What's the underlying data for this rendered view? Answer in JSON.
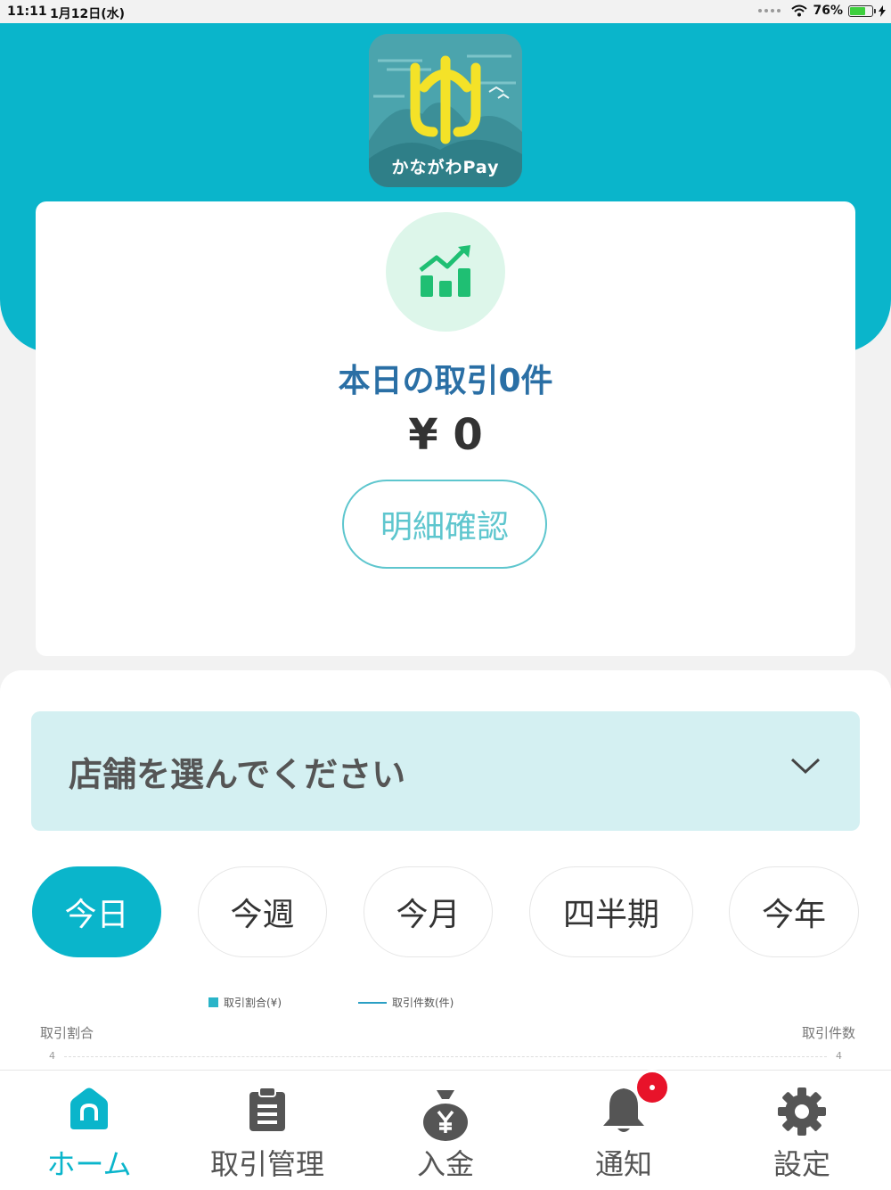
{
  "status_bar": {
    "time": "11:11",
    "date": "1月12日(水)",
    "battery": "76%",
    "battery_level": 0.76
  },
  "header": {
    "logo_caption": "かながわPay"
  },
  "summary": {
    "today_count": "本日の取引0件",
    "today_amount": "¥ 0",
    "detail_button": "明細確認"
  },
  "store_select": {
    "placeholder": "店舗を選んでください"
  },
  "period_tabs": [
    {
      "label": "今日",
      "active": true
    },
    {
      "label": "今週",
      "active": false
    },
    {
      "label": "今月",
      "active": false
    },
    {
      "label": "四半期",
      "active": false
    },
    {
      "label": "今年",
      "active": false
    }
  ],
  "chart": {
    "legend_bar": "取引割合(¥)",
    "legend_line": "取引件数(件)",
    "left_axis": "取引割合",
    "right_axis": "取引件数",
    "left_tick": "4",
    "right_tick": "4"
  },
  "nav": [
    {
      "label": "ホーム",
      "icon": "home-icon",
      "active": true
    },
    {
      "label": "取引管理",
      "icon": "clipboard-icon",
      "active": false
    },
    {
      "label": "入金",
      "icon": "money-bag-icon",
      "active": false
    },
    {
      "label": "通知",
      "icon": "bell-icon",
      "active": false
    },
    {
      "label": "設定",
      "icon": "gear-icon",
      "active": false
    }
  ],
  "colors": {
    "brand": "#0ab5cb",
    "title_blue": "#2a6fa5",
    "chart_green": "#1fbf73",
    "badge_red": "#e8132a"
  }
}
